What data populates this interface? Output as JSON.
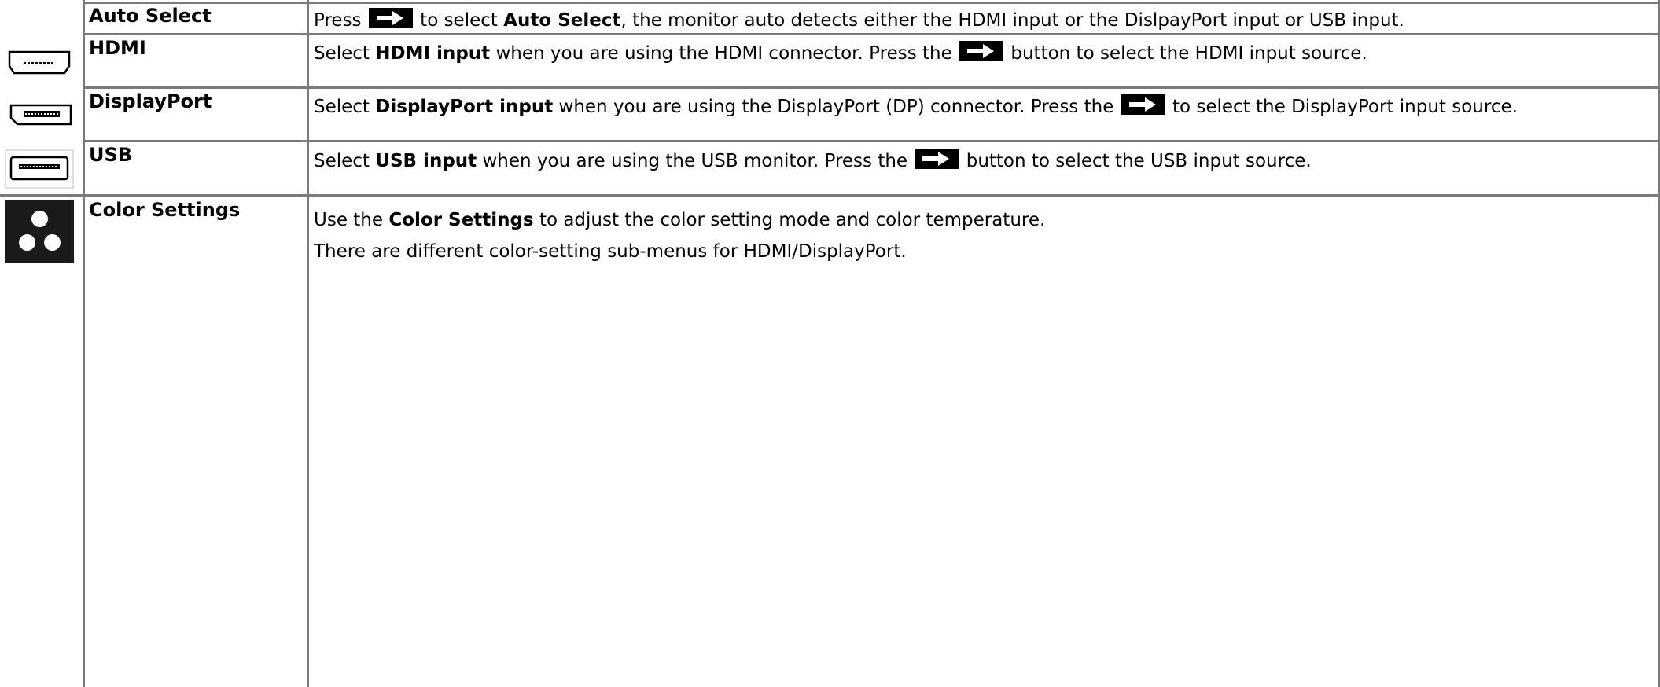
{
  "rows": [
    {
      "label": "Auto Select",
      "icon": "",
      "desc": {
        "pre": "Press",
        "mid": "to select",
        "bold": "Auto Select",
        "post": ", the monitor auto detects either the HDMI input or the DislpayPort input or USB input."
      }
    },
    {
      "label": "HDMI",
      "icon": "hdmi-port-icon",
      "desc": {
        "pre": "Select",
        "bold": "HDMI input",
        "mid": "when you are using the HDMI connector. Press the",
        "post": "button to select the HDMI input source."
      }
    },
    {
      "label": "DisplayPort",
      "icon": "displayport-icon",
      "desc": {
        "pre": "Select",
        "bold": "DisplayPort input",
        "mid": "when you are using the DisplayPort (DP) connector. Press the",
        "post": "to select the DisplayPort input source."
      }
    },
    {
      "label": "USB",
      "icon": "usb-port-icon",
      "desc": {
        "pre": "Select",
        "bold": "USB input",
        "mid": "when you are using the USB monitor. Press the",
        "post": "button to select the USB input source."
      }
    },
    {
      "label": "Color Settings",
      "icon": "color-settings-icon",
      "desc": {
        "pre": "Use the",
        "bold": "Color Settings",
        "post": "to adjust the color setting mode and color temperature.",
        "line2": "There are different color-setting sub-menus for HDMI/DisplayPort."
      }
    }
  ],
  "colors": {
    "grid": "#7a7a7a",
    "key": "#000000",
    "tile": "#1a1a1a"
  }
}
